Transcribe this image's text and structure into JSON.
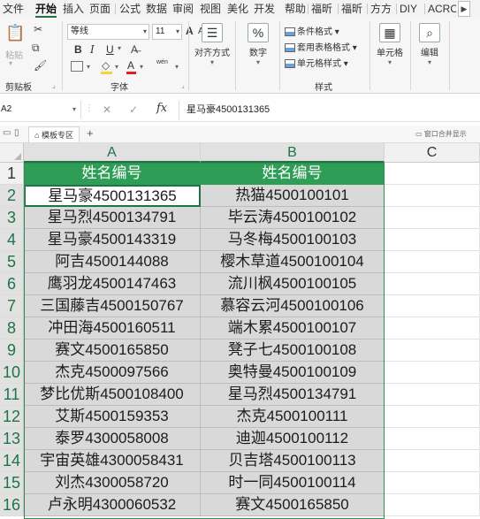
{
  "tabs": [
    "文件",
    "开始",
    "插入",
    "页面",
    "公式",
    "数据",
    "审阅",
    "视图",
    "美化",
    "开发",
    "帮助",
    "福昕",
    "福昕",
    "方方",
    "DIY",
    "ACRO"
  ],
  "active_tab": "开始",
  "ribbon": {
    "clipboard": {
      "paste_label": "粘贴",
      "group_label": "剪贴板"
    },
    "font": {
      "font_name": "等线",
      "font_size": "11",
      "bold": "B",
      "italic": "I",
      "underline": "U",
      "grow_font": "A",
      "shrink_font": "A",
      "font_color_glyph": "A",
      "phonetic_glyph": "wén",
      "group_label": "字体"
    },
    "alignment": {
      "label": "对齐方式"
    },
    "number": {
      "glyph": "%",
      "label": "数字"
    },
    "styles": {
      "conditional_format": "条件格式",
      "table_format": "套用表格格式",
      "cell_styles": "单元格样式",
      "group_label": "样式"
    },
    "cells": {
      "label": "单元格"
    },
    "editing": {
      "label": "编辑"
    }
  },
  "formula_bar": {
    "name_box": "A2",
    "fx": "fx",
    "formula": "星马豪4500131365"
  },
  "workbook_tabs": {
    "tab_label": "模板专区",
    "add": "+",
    "right_label": "窗口合并显示"
  },
  "sheet": {
    "columns": [
      "A",
      "B",
      "C"
    ],
    "rows": [
      [
        "姓名编号",
        "姓名编号"
      ],
      [
        "星马豪4500131365",
        "热猫4500100101"
      ],
      [
        "星马烈4500134791",
        "毕云涛4500100102"
      ],
      [
        "星马豪4500143319",
        "马冬梅4500100103"
      ],
      [
        "阿吉4500144088",
        "樱木草道4500100104"
      ],
      [
        "鹰羽龙4500147463",
        "流川枫4500100105"
      ],
      [
        "三国藤吉4500150767",
        "慕容云河4500100106"
      ],
      [
        "冲田海4500160511",
        "端木累4500100107"
      ],
      [
        "赛文4500165850",
        "凳子七4500100108"
      ],
      [
        "杰克4500097566",
        "奥特曼4500100109"
      ],
      [
        "梦比优斯4500108400",
        "星马烈4500134791"
      ],
      [
        "艾斯4500159353",
        "杰克4500100111"
      ],
      [
        "泰罗4300058008",
        "迪迦4500100112"
      ],
      [
        "宇宙英雄4300058431",
        "贝吉塔4500100113"
      ],
      [
        "刘杰4300058720",
        "时一同4500100114"
      ],
      [
        "卢永明4300060532",
        "赛文4500165850"
      ]
    ],
    "active_cell": "A2",
    "header_color": "#2e9e56"
  }
}
